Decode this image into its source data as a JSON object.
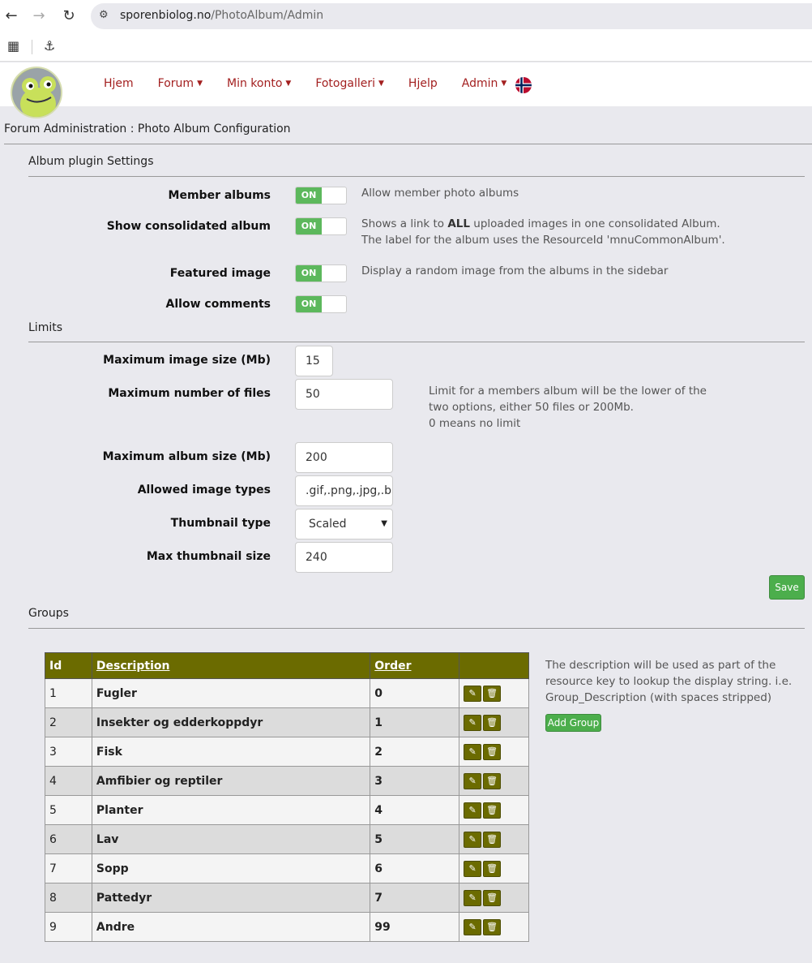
{
  "browser": {
    "url_domain": "sporenbiolog.no",
    "url_path": "/PhotoAlbum/Admin"
  },
  "menu": {
    "home": "Hjem",
    "forum": "Forum",
    "account": "Min konto",
    "gallery": "Fotogalleri",
    "help": "Hjelp",
    "admin": "Admin"
  },
  "breadcrumb": "Forum Administration : Photo Album Configuration",
  "album_settings": {
    "title": "Album plugin Settings",
    "member_albums": {
      "label": "Member albums",
      "state": "ON",
      "help": "Allow member photo albums"
    },
    "consolidated": {
      "label": "Show consolidated album",
      "state": "ON",
      "help_prefix": "Shows a link to ",
      "help_bold": "ALL",
      "help_suffix": " uploaded images in one consolidated Album. The label for the album uses the ResourceId 'mnuCommonAlbum'."
    },
    "featured": {
      "label": "Featured image",
      "state": "ON",
      "help": "Display a random image from the albums in the sidebar"
    },
    "comments": {
      "label": "Allow comments",
      "state": "ON"
    }
  },
  "limits": {
    "title": "Limits",
    "max_image_size": {
      "label": "Maximum image size (Mb)",
      "value": "15"
    },
    "max_files": {
      "label": "Maximum number of files",
      "value": "50",
      "help_1": "Limit for a members album will be the lower of the two options, either 50 files or 200Mb.",
      "help_2": "0 means no limit"
    },
    "max_album_size": {
      "label": "Maximum album size (Mb)",
      "value": "200"
    },
    "image_types": {
      "label": "Allowed image types",
      "value": ".gif,.png,.jpg,.b"
    },
    "thumb_type": {
      "label": "Thumbnail type",
      "value": "Scaled"
    },
    "max_thumb": {
      "label": "Max thumbnail size",
      "value": "240"
    },
    "save": "Save"
  },
  "groups": {
    "title": "Groups",
    "headers": {
      "id": "Id",
      "description": "Description",
      "order": "Order"
    },
    "help": "The description will be used as part of the resource key to lookup the display string. i.e. Group_Description (with spaces stripped)",
    "add": "Add Group",
    "rows": [
      {
        "id": "1",
        "description": "Fugler",
        "order": "0"
      },
      {
        "id": "2",
        "description": "Insekter og edderkoppdyr",
        "order": "1"
      },
      {
        "id": "3",
        "description": "Fisk",
        "order": "2"
      },
      {
        "id": "4",
        "description": "Amfibier og reptiler",
        "order": "3"
      },
      {
        "id": "5",
        "description": "Planter",
        "order": "4"
      },
      {
        "id": "6",
        "description": "Lav",
        "order": "5"
      },
      {
        "id": "7",
        "description": "Sopp",
        "order": "6"
      },
      {
        "id": "8",
        "description": "Pattedyr",
        "order": "7"
      },
      {
        "id": "9",
        "description": "Andre",
        "order": "99"
      }
    ]
  },
  "colors": {
    "menu_link": "#a32020",
    "toggle_on": "#5cb85c",
    "table_header": "#6b6b00",
    "button_green": "#4cae4c"
  }
}
